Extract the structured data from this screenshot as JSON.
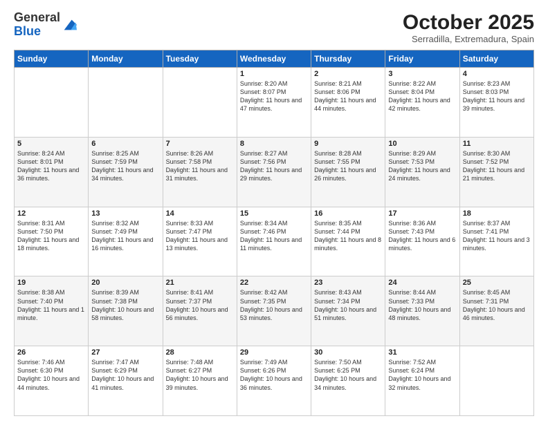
{
  "header": {
    "logo_general": "General",
    "logo_blue": "Blue",
    "month_title": "October 2025",
    "location": "Serradilla, Extremadura, Spain"
  },
  "days_of_week": [
    "Sunday",
    "Monday",
    "Tuesday",
    "Wednesday",
    "Thursday",
    "Friday",
    "Saturday"
  ],
  "weeks": [
    [
      {
        "day": "",
        "info": ""
      },
      {
        "day": "",
        "info": ""
      },
      {
        "day": "",
        "info": ""
      },
      {
        "day": "1",
        "info": "Sunrise: 8:20 AM\nSunset: 8:07 PM\nDaylight: 11 hours and 47 minutes."
      },
      {
        "day": "2",
        "info": "Sunrise: 8:21 AM\nSunset: 8:06 PM\nDaylight: 11 hours and 44 minutes."
      },
      {
        "day": "3",
        "info": "Sunrise: 8:22 AM\nSunset: 8:04 PM\nDaylight: 11 hours and 42 minutes."
      },
      {
        "day": "4",
        "info": "Sunrise: 8:23 AM\nSunset: 8:03 PM\nDaylight: 11 hours and 39 minutes."
      }
    ],
    [
      {
        "day": "5",
        "info": "Sunrise: 8:24 AM\nSunset: 8:01 PM\nDaylight: 11 hours and 36 minutes."
      },
      {
        "day": "6",
        "info": "Sunrise: 8:25 AM\nSunset: 7:59 PM\nDaylight: 11 hours and 34 minutes."
      },
      {
        "day": "7",
        "info": "Sunrise: 8:26 AM\nSunset: 7:58 PM\nDaylight: 11 hours and 31 minutes."
      },
      {
        "day": "8",
        "info": "Sunrise: 8:27 AM\nSunset: 7:56 PM\nDaylight: 11 hours and 29 minutes."
      },
      {
        "day": "9",
        "info": "Sunrise: 8:28 AM\nSunset: 7:55 PM\nDaylight: 11 hours and 26 minutes."
      },
      {
        "day": "10",
        "info": "Sunrise: 8:29 AM\nSunset: 7:53 PM\nDaylight: 11 hours and 24 minutes."
      },
      {
        "day": "11",
        "info": "Sunrise: 8:30 AM\nSunset: 7:52 PM\nDaylight: 11 hours and 21 minutes."
      }
    ],
    [
      {
        "day": "12",
        "info": "Sunrise: 8:31 AM\nSunset: 7:50 PM\nDaylight: 11 hours and 18 minutes."
      },
      {
        "day": "13",
        "info": "Sunrise: 8:32 AM\nSunset: 7:49 PM\nDaylight: 11 hours and 16 minutes."
      },
      {
        "day": "14",
        "info": "Sunrise: 8:33 AM\nSunset: 7:47 PM\nDaylight: 11 hours and 13 minutes."
      },
      {
        "day": "15",
        "info": "Sunrise: 8:34 AM\nSunset: 7:46 PM\nDaylight: 11 hours and 11 minutes."
      },
      {
        "day": "16",
        "info": "Sunrise: 8:35 AM\nSunset: 7:44 PM\nDaylight: 11 hours and 8 minutes."
      },
      {
        "day": "17",
        "info": "Sunrise: 8:36 AM\nSunset: 7:43 PM\nDaylight: 11 hours and 6 minutes."
      },
      {
        "day": "18",
        "info": "Sunrise: 8:37 AM\nSunset: 7:41 PM\nDaylight: 11 hours and 3 minutes."
      }
    ],
    [
      {
        "day": "19",
        "info": "Sunrise: 8:38 AM\nSunset: 7:40 PM\nDaylight: 11 hours and 1 minute."
      },
      {
        "day": "20",
        "info": "Sunrise: 8:39 AM\nSunset: 7:38 PM\nDaylight: 10 hours and 58 minutes."
      },
      {
        "day": "21",
        "info": "Sunrise: 8:41 AM\nSunset: 7:37 PM\nDaylight: 10 hours and 56 minutes."
      },
      {
        "day": "22",
        "info": "Sunrise: 8:42 AM\nSunset: 7:35 PM\nDaylight: 10 hours and 53 minutes."
      },
      {
        "day": "23",
        "info": "Sunrise: 8:43 AM\nSunset: 7:34 PM\nDaylight: 10 hours and 51 minutes."
      },
      {
        "day": "24",
        "info": "Sunrise: 8:44 AM\nSunset: 7:33 PM\nDaylight: 10 hours and 48 minutes."
      },
      {
        "day": "25",
        "info": "Sunrise: 8:45 AM\nSunset: 7:31 PM\nDaylight: 10 hours and 46 minutes."
      }
    ],
    [
      {
        "day": "26",
        "info": "Sunrise: 7:46 AM\nSunset: 6:30 PM\nDaylight: 10 hours and 44 minutes."
      },
      {
        "day": "27",
        "info": "Sunrise: 7:47 AM\nSunset: 6:29 PM\nDaylight: 10 hours and 41 minutes."
      },
      {
        "day": "28",
        "info": "Sunrise: 7:48 AM\nSunset: 6:27 PM\nDaylight: 10 hours and 39 minutes."
      },
      {
        "day": "29",
        "info": "Sunrise: 7:49 AM\nSunset: 6:26 PM\nDaylight: 10 hours and 36 minutes."
      },
      {
        "day": "30",
        "info": "Sunrise: 7:50 AM\nSunset: 6:25 PM\nDaylight: 10 hours and 34 minutes."
      },
      {
        "day": "31",
        "info": "Sunrise: 7:52 AM\nSunset: 6:24 PM\nDaylight: 10 hours and 32 minutes."
      },
      {
        "day": "",
        "info": ""
      }
    ]
  ]
}
